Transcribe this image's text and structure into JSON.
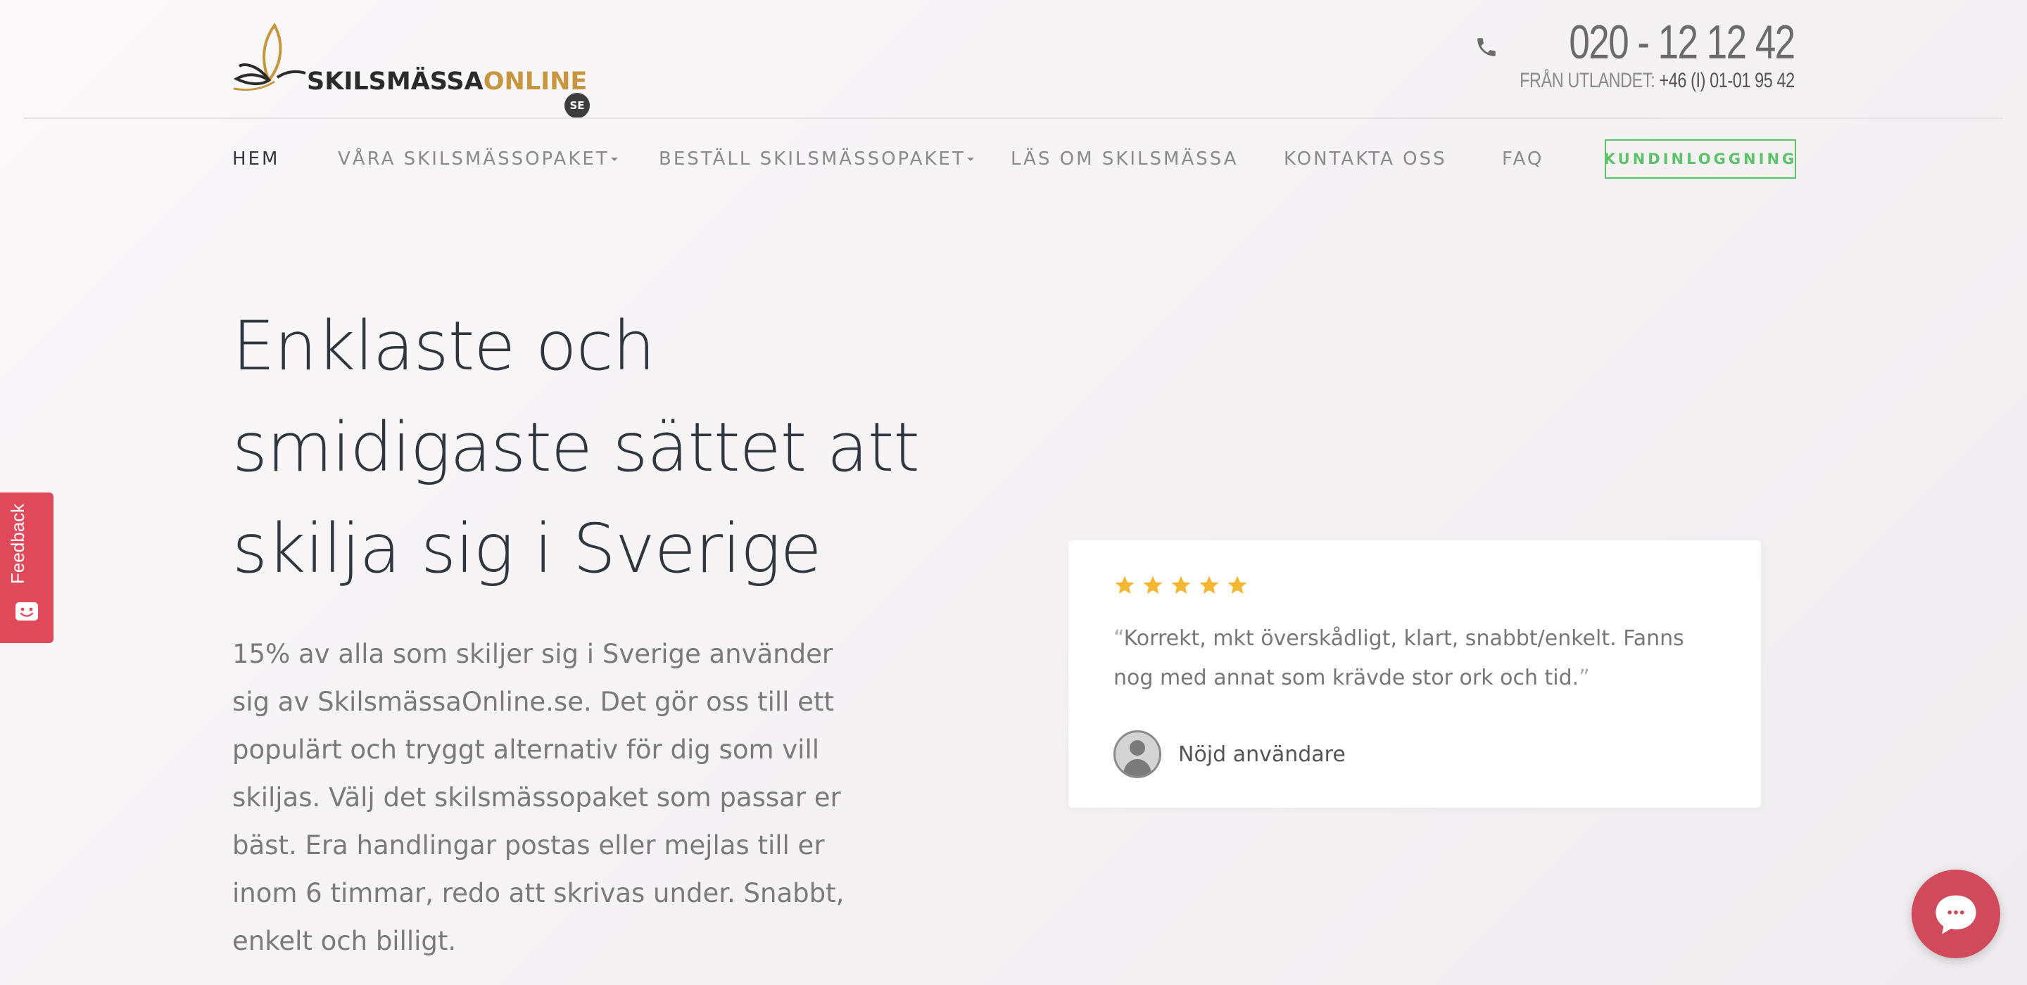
{
  "header": {
    "logo": {
      "text_dark": "SKILSMÄSSA",
      "text_gold": "ONLINE",
      "badge": "SE"
    },
    "phone": {
      "number": "020 - 12 12 42",
      "abroad_label": "FRÅN UTLANDET:",
      "abroad_number": "+46 (I) 01-01 95 42"
    }
  },
  "nav": {
    "items": [
      {
        "label": "HEM",
        "active": true
      },
      {
        "label": "VÅRA SKILSMÄSSOPAKET",
        "dropdown": true
      },
      {
        "label": "BESTÄLL SKILSMÄSSOPAKET",
        "dropdown": true
      },
      {
        "label": "LÄS OM SKILSMÄSSA"
      },
      {
        "label": "KONTAKTA OSS"
      },
      {
        "label": "FAQ"
      }
    ],
    "login_label": "KUNDINLOGGNING"
  },
  "hero": {
    "title_lines": [
      "Enklaste och",
      "smidigaste sättet att",
      "skilja sig i Sverige"
    ],
    "text": "15% av alla som skiljer sig i Sverige använder sig av SkilsmässaOnline.se. Det gör oss till ett populärt och tryggt alternativ för dig som vill skiljas. Välj det skilsmässopaket som passar er bäst. Era handlingar postas eller mejlas till er inom 6 timmar, redo att skrivas under. Snabbt, enkelt och billigt."
  },
  "review": {
    "rating": 5,
    "quote": "Korrekt, mkt överskådligt, klart, snabbt/enkelt. Fanns nog med annat som krävde stor ork och tid.",
    "open_quote": "“",
    "close_quote": "”",
    "reviewer": "Nöjd användare"
  },
  "feedback": {
    "label": "Feedback"
  },
  "colors": {
    "accent_green": "#5cc36a",
    "gold": "#c8963e",
    "feedback_red": "#e0495a",
    "chat_red": "#d14a5c",
    "star_yellow": "#f5b731"
  },
  "icons": [
    "phone-icon",
    "star-icon",
    "avatar-icon",
    "feedback-face-icon",
    "chat-icon"
  ]
}
